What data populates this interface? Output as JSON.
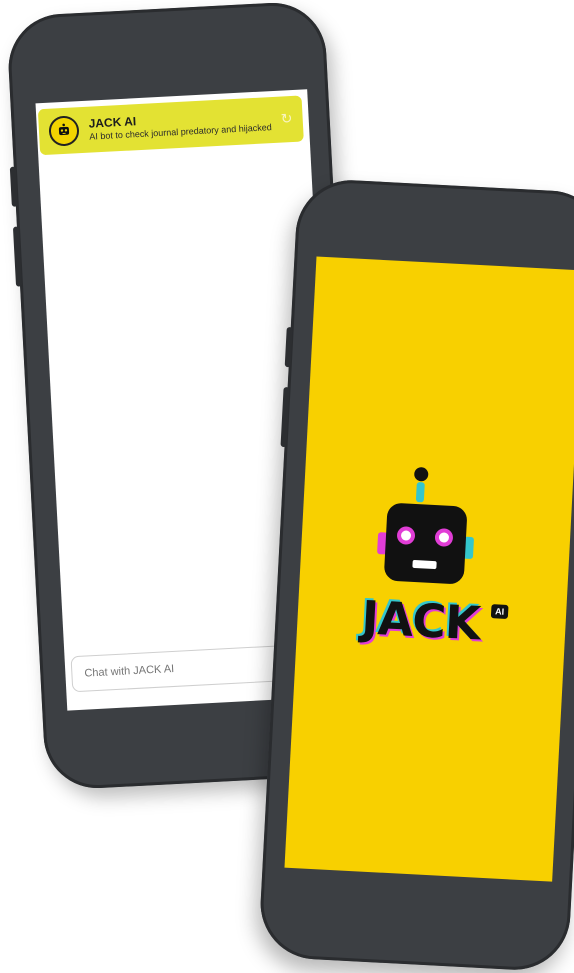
{
  "chat": {
    "title": "JACK AI",
    "subtitle": "AI bot to check journal predatory and hijacked",
    "input_placeholder": "Chat with JACK AI",
    "refresh_icon": "refresh-icon"
  },
  "splash": {
    "brand": "JACK",
    "badge": "AI",
    "background_color": "#f8d000"
  }
}
